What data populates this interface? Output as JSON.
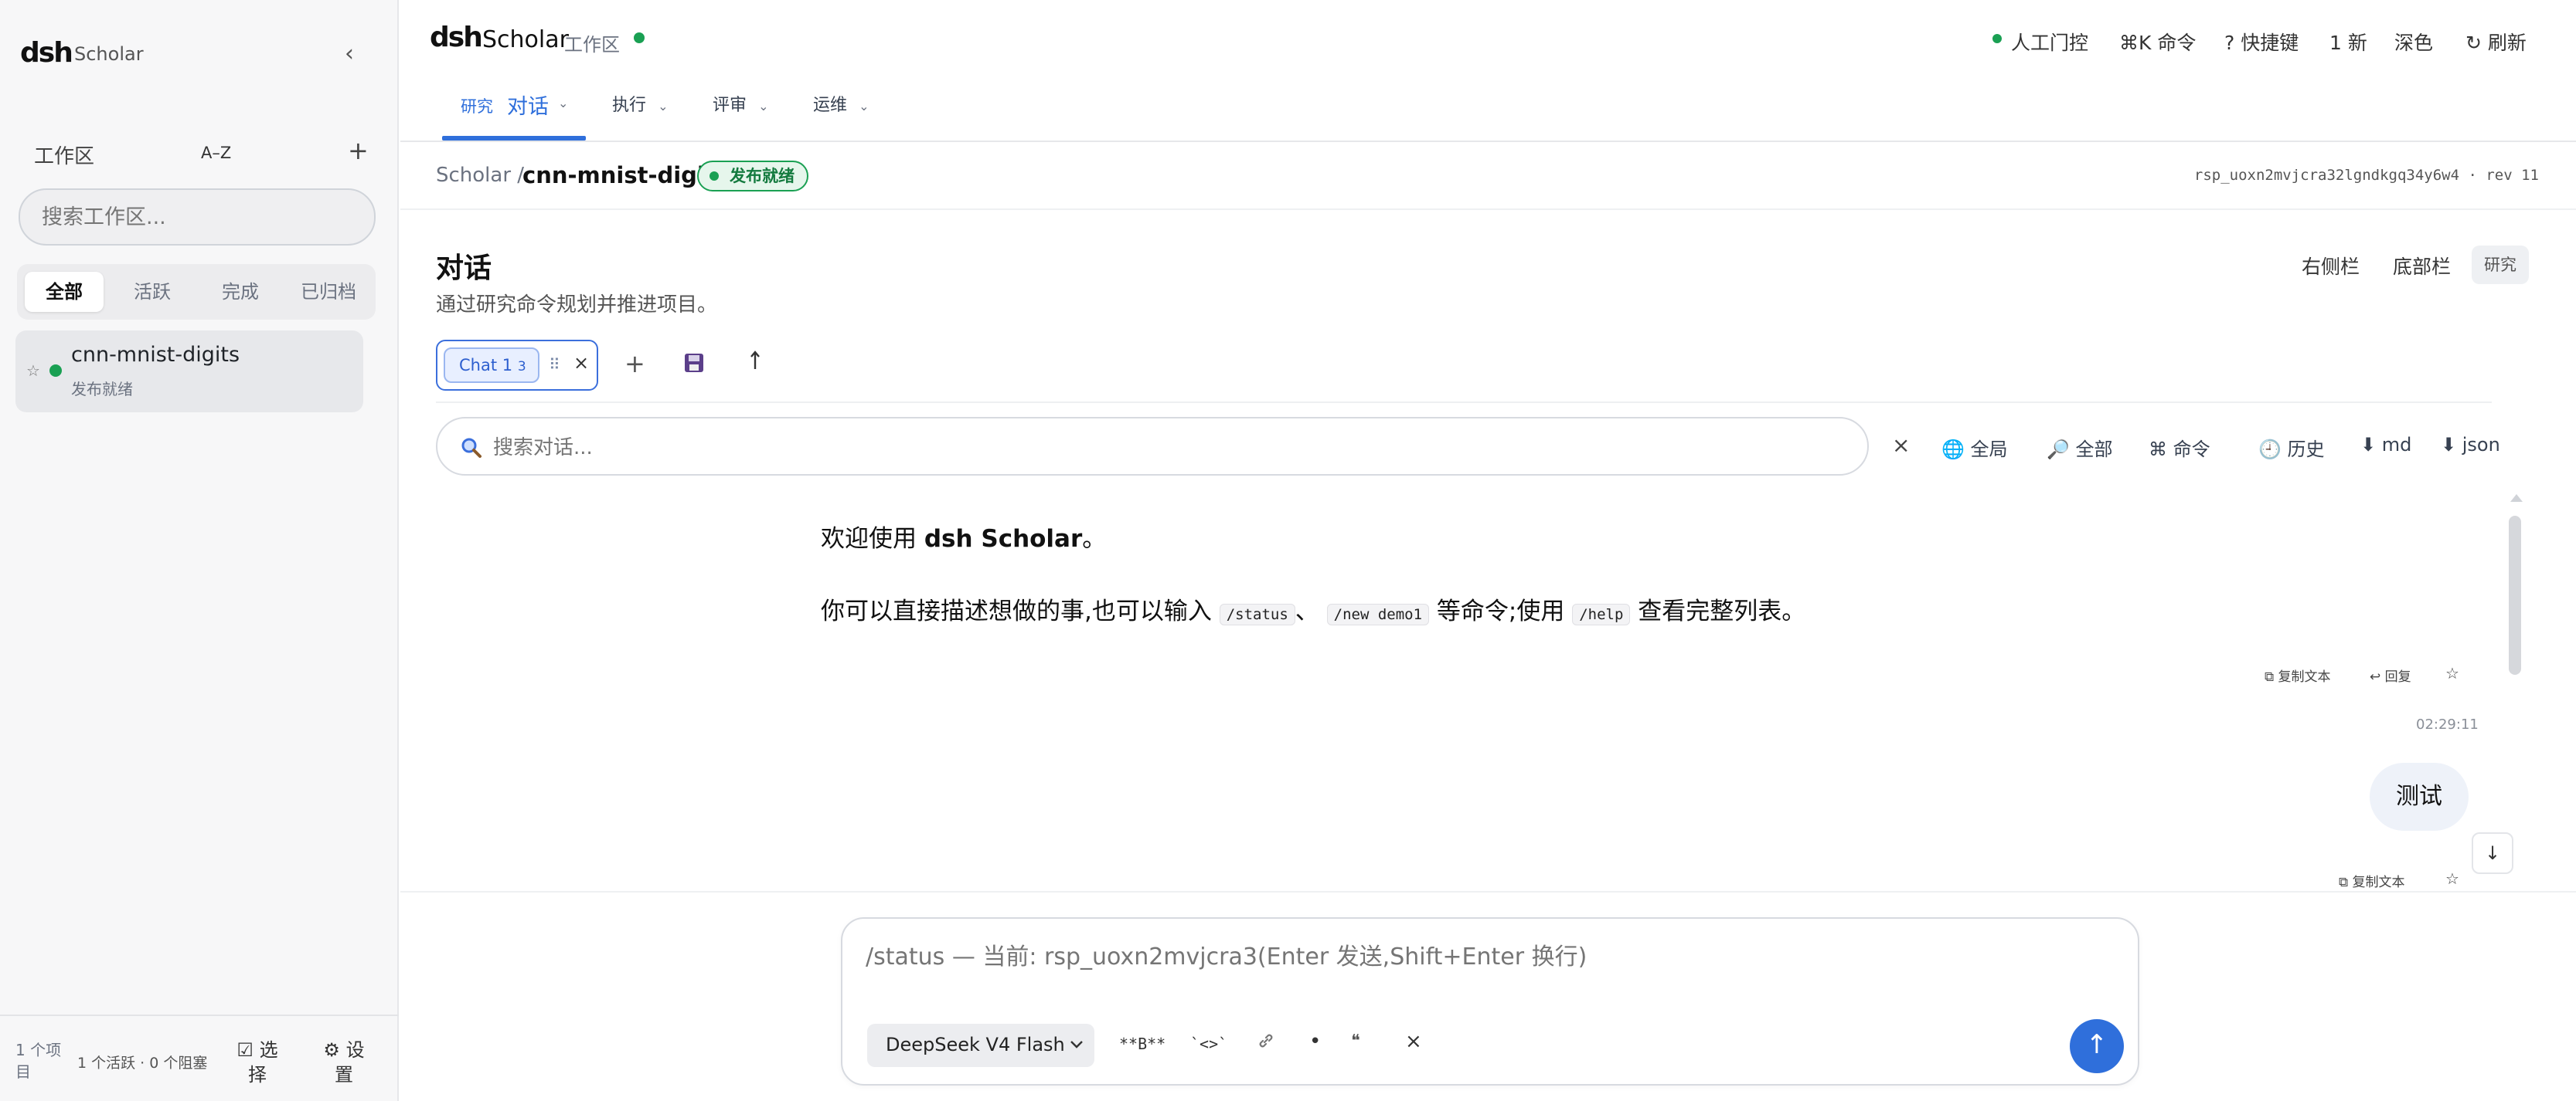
{
  "sidebar": {
    "logo": "dsh",
    "app_name": "Scholar",
    "collapse_icon": "‹",
    "workspace_title": "工作区",
    "sort_label": "A–Z",
    "add_icon": "+",
    "search_placeholder": "搜索工作区...",
    "filters": [
      "全部",
      "活跃",
      "完成",
      "已归档"
    ],
    "project": {
      "star": "☆",
      "name": "cnn-mnist-digits",
      "status": "发布就绪"
    },
    "footer": {
      "count": "1 个项目",
      "summary": "1 个活跃 · 0 个阻塞",
      "select": "☑ 选择",
      "settings": "⚙ 设置"
    }
  },
  "header": {
    "logo": "dsh",
    "app_name": "Scholar",
    "workspace": "工作区",
    "actions": [
      "人工门控",
      "⌘K 命令",
      "? 快捷键",
      "1 新",
      "深色",
      "↻ 刷新"
    ],
    "tabs": [
      {
        "small": "研究",
        "label": "对话"
      },
      {
        "small": "",
        "label": "执行"
      },
      {
        "small": "",
        "label": "评审"
      },
      {
        "small": "",
        "label": "运维"
      }
    ],
    "chevron": "⌄"
  },
  "breadcrumb": {
    "root": "Scholar /",
    "project": "cnn-mnist-digits",
    "badge": "发布就绪",
    "rev": "rsp_uoxn2mvjcra32lgndkgq34y6w4 · rev 11"
  },
  "page": {
    "title": "对话",
    "subtitle": "通过研究命令规划并推进项目。",
    "right_buttons": [
      "右侧栏",
      "底部栏",
      "研究"
    ]
  },
  "chat_tabs": {
    "chip_label": "Chat 1",
    "chip_count": "3",
    "menu_icon": "⠿",
    "close_icon": "×",
    "add_icon": "+",
    "save_icon": "💾",
    "export_icon": "⬆"
  },
  "chat_search": {
    "placeholder": "搜索对话...",
    "clear": "×",
    "tools": [
      "🌐 全局",
      "🔎 全部",
      "⌘ 命令",
      "🕘 历史",
      "⬇ md",
      "⬇ json"
    ]
  },
  "messages": {
    "welcome_prefix": "欢迎使用 ",
    "welcome_bold": "dsh Scholar",
    "welcome_suffix": "。",
    "help_1": "你可以直接描述想做的事,也可以输入 ",
    "code_status": "/status",
    "sep": "、",
    "code_new": "/new demo1",
    "help_2": " 等命令;使用 ",
    "code_help": "/help",
    "help_3": " 查看完整列表。",
    "actions_1": [
      "⧉ 复制文本",
      "↩ 回复",
      "☆"
    ],
    "timestamp": "02:29:11",
    "user_message": "测试",
    "actions_2": [
      "⧉ 复制文本",
      "☆"
    ],
    "scroll_down": "↓"
  },
  "composer": {
    "placeholder": "/status — 当前: rsp_uoxn2mvjcra3(Enter 发送,Shift+Enter 换行)",
    "model": "DeepSeek V4 Flash",
    "format_buttons": [
      "**B**",
      "`<>`",
      "🔗",
      "•",
      "❝",
      "×"
    ],
    "send_icon": "↑"
  },
  "colors": {
    "accent": "#2f6fdb",
    "status_green": "#1aa053"
  }
}
